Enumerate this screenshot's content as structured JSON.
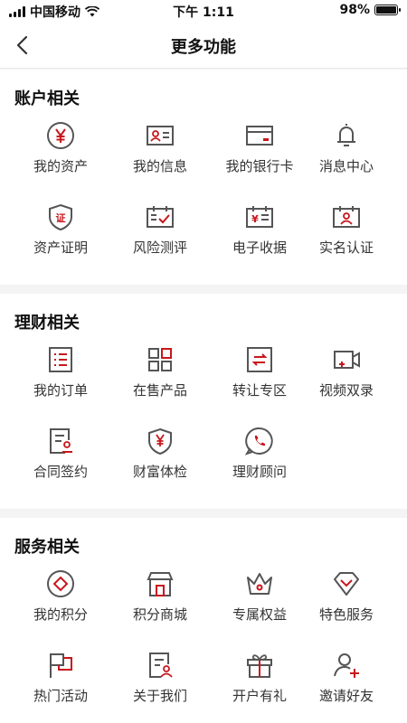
{
  "status_bar": {
    "carrier": "中国移动",
    "time": "下午 1:11",
    "battery": "98%"
  },
  "nav": {
    "title": "更多功能"
  },
  "sections": [
    {
      "title": "账户相关",
      "items": [
        {
          "label": "我的资产",
          "icon": "yen-circle-icon"
        },
        {
          "label": "我的信息",
          "icon": "id-card-icon"
        },
        {
          "label": "我的银行卡",
          "icon": "bank-card-icon"
        },
        {
          "label": "消息中心",
          "icon": "bell-icon"
        },
        {
          "label": "资产证明",
          "icon": "certificate-shield-icon"
        },
        {
          "label": "风险测评",
          "icon": "calendar-check-icon"
        },
        {
          "label": "电子收据",
          "icon": "receipt-icon"
        },
        {
          "label": "实名认证",
          "icon": "realname-calendar-icon"
        }
      ]
    },
    {
      "title": "理财相关",
      "items": [
        {
          "label": "我的订单",
          "icon": "order-list-icon"
        },
        {
          "label": "在售产品",
          "icon": "grid-apps-icon"
        },
        {
          "label": "转让专区",
          "icon": "transfer-icon"
        },
        {
          "label": "视频双录",
          "icon": "video-camera-icon"
        },
        {
          "label": "合同签约",
          "icon": "contract-sign-icon"
        },
        {
          "label": "财富体检",
          "icon": "wealth-shield-icon"
        },
        {
          "label": "理财顾问",
          "icon": "phone-chat-icon"
        }
      ]
    },
    {
      "title": "服务相关",
      "items": [
        {
          "label": "我的积分",
          "icon": "points-diamond-icon"
        },
        {
          "label": "积分商城",
          "icon": "store-icon"
        },
        {
          "label": "专属权益",
          "icon": "crown-icon"
        },
        {
          "label": "特色服务",
          "icon": "gem-icon"
        },
        {
          "label": "热门活动",
          "icon": "flag-icon"
        },
        {
          "label": "关于我们",
          "icon": "about-doc-icon"
        },
        {
          "label": "开户有礼",
          "icon": "gift-icon"
        },
        {
          "label": "邀请好友",
          "icon": "invite-user-icon"
        }
      ]
    }
  ],
  "colors": {
    "icon_gray": "#555555",
    "accent_red": "#c8161d"
  }
}
